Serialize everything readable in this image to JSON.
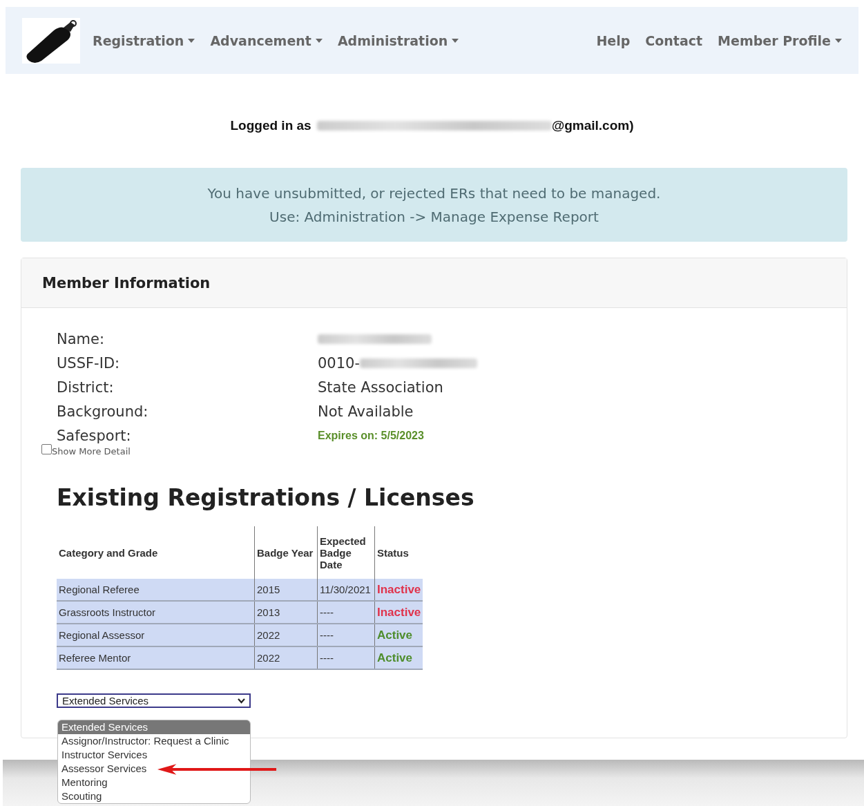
{
  "navbar": {
    "menus": [
      {
        "label": "Registration",
        "dropdown": true
      },
      {
        "label": "Advancement",
        "dropdown": true
      },
      {
        "label": "Administration",
        "dropdown": true
      }
    ],
    "right_menus": [
      {
        "label": "Help",
        "dropdown": false
      },
      {
        "label": "Contact",
        "dropdown": false
      },
      {
        "label": "Member Profile",
        "dropdown": true
      }
    ]
  },
  "login": {
    "prefix": "Logged in as",
    "suffix": "@gmail.com)"
  },
  "alert": {
    "lines": [
      "You have unsubmitted, or rejected ERs that need to be managed.",
      "Use: Administration -> Manage Expense Report"
    ]
  },
  "member_card": {
    "title": "Member Information",
    "fields": [
      {
        "label": "Name:",
        "kind": "blurred"
      },
      {
        "label": "USSF-ID:",
        "value": "0010-",
        "kind": "partial"
      },
      {
        "label": "District:",
        "value": "State Association",
        "kind": "text"
      },
      {
        "label": "Background:",
        "value": "Not Available",
        "kind": "text"
      },
      {
        "label": "Safesport:",
        "value": "Expires on: 5/5/2023",
        "kind": "ok"
      }
    ],
    "show_more": {
      "label": "Show More Detail",
      "checked": false
    },
    "heading": "Existing Registrations / Licenses",
    "table": {
      "columns": [
        "Category and Grade",
        "Badge Year",
        "Expected Badge Date",
        "Status"
      ],
      "rows": [
        {
          "category": "Regional Referee",
          "year": "2015",
          "date": "11/30/2021",
          "status": "Inactive",
          "active": false
        },
        {
          "category": "Grassroots Instructor",
          "year": "2013",
          "date": "----",
          "status": "Inactive",
          "active": false
        },
        {
          "category": "Regional Assessor",
          "year": "2022",
          "date": "----",
          "status": "Active",
          "active": true
        },
        {
          "category": "Referee Mentor",
          "year": "2022",
          "date": "----",
          "status": "Active",
          "active": true
        }
      ]
    },
    "services_select": {
      "value": "Extended Services",
      "options": [
        {
          "label": "Extended Services",
          "selected": true
        },
        {
          "label": "Assignor/Instructor: Request a Clinic",
          "selected": false
        },
        {
          "label": "Instructor Services",
          "selected": false
        },
        {
          "label": "Assessor Services",
          "selected": false,
          "pointed": true
        },
        {
          "label": "Mentoring",
          "selected": false
        },
        {
          "label": "Scouting",
          "selected": false
        }
      ]
    }
  }
}
